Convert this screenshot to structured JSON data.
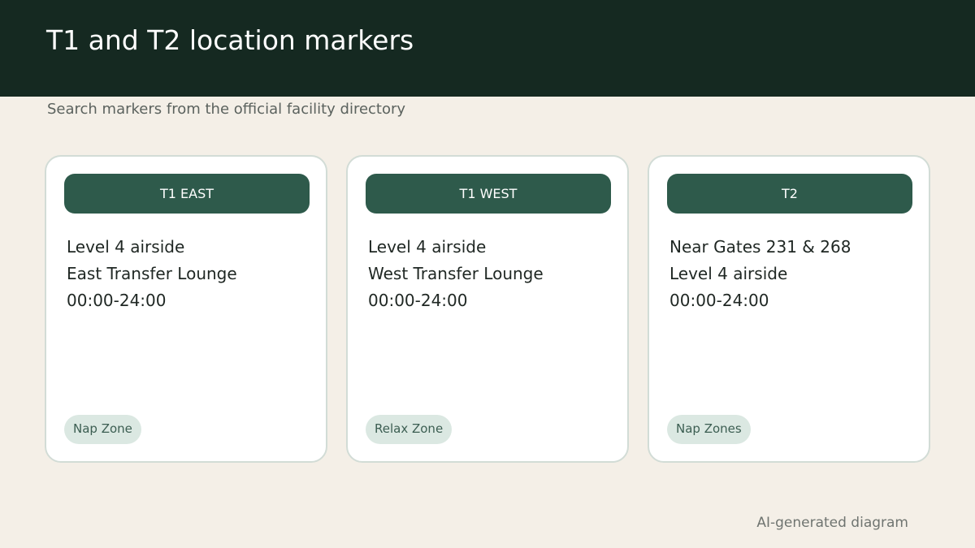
{
  "header": {
    "title": "T1 and T2 location markers",
    "subtitle": "Search markers from the official facility directory"
  },
  "cards": [
    {
      "heading": "T1 EAST",
      "lines": [
        "Level 4 airside",
        "East Transfer Lounge",
        "00:00-24:00"
      ],
      "tag": "Nap Zone"
    },
    {
      "heading": "T1 WEST",
      "lines": [
        "Level 4 airside",
        "West Transfer Lounge",
        "00:00-24:00"
      ],
      "tag": "Relax Zone"
    },
    {
      "heading": "T2",
      "lines": [
        "Near Gates 231 & 268",
        "Level 4 airside",
        "00:00-24:00"
      ],
      "tag": "Nap Zones"
    }
  ],
  "footer": {
    "note": "AI-generated diagram"
  },
  "colors": {
    "header_bg": "#152921",
    "page_bg": "#f4efe7",
    "card_head_bg": "#2e5a4b",
    "tag_bg": "#dbe8e2",
    "tag_text": "#3c5e52"
  }
}
